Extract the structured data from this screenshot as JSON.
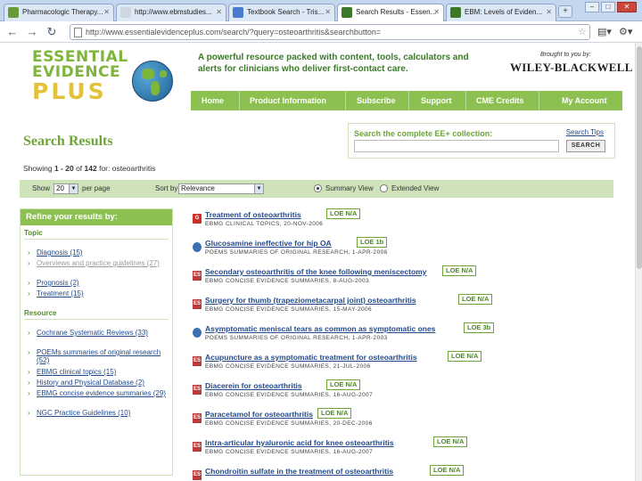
{
  "browser": {
    "tabs": [
      {
        "label": "Pharmacologic Therapy...",
        "favicon": "#6a9a3a",
        "active": false
      },
      {
        "label": "http://www.ebmstudies...",
        "favicon": "#cfd6e0",
        "active": false
      },
      {
        "label": "Textbook Search - Tris...",
        "favicon": "#4a7ad0",
        "active": false
      },
      {
        "label": "Search Results - Essen...",
        "favicon": "#3c7a2a",
        "active": true
      },
      {
        "label": "EBM: Levels of Eviden...",
        "favicon": "#3c7a2a",
        "active": false
      }
    ],
    "url": "http://www.essentialevidenceplus.com/search/?query=osteoarthritis&searchbutton="
  },
  "header": {
    "logo_line1": "ESSENTIAL",
    "logo_line2": "EVIDENCE",
    "logo_line3": "PLUS",
    "tagline": "A powerful resource packed with content, tools, calculators and alerts for clinicians who deliver first-contact care.",
    "brought_by": "Brought to you by:",
    "publisher": "WILEY-BLACKWELL"
  },
  "nav": {
    "items": [
      "Home",
      "Product Information",
      "Subscribe",
      "Support",
      "CME Credits",
      "My Account"
    ]
  },
  "search": {
    "title": "Search Results",
    "collection_label": "Search the complete EE+ collection:",
    "tips": "Search Tips",
    "button": "SEARCH",
    "query_value": ""
  },
  "showing": {
    "prefix": "Showing ",
    "range": "1 - 20",
    "mid": " of ",
    "total": "142",
    "suffix": " for: osteoarthritis"
  },
  "controls": {
    "show_label": "Show",
    "show_value": "20",
    "per_page": "per page",
    "sort_label": "Sort by",
    "sort_value": "Relevance",
    "summary_view": "Summary View",
    "extended_view": "Extended View"
  },
  "refine": {
    "heading": "Refine your results by:",
    "topic_label": "Topic",
    "topics": [
      {
        "label": "Diagnosis (15)",
        "dim": false
      },
      {
        "label": "Overviews and practice guidelines (27)",
        "dim": true
      },
      {
        "label": "Prognosis (2)",
        "dim": false
      },
      {
        "label": "Treatment (15)",
        "dim": false
      }
    ],
    "resource_label": "Resource",
    "resources": [
      "Cochrane Systematic Reviews (33)",
      "POEMs summaries of original research (52)",
      "EBMG clinical topics (15)",
      "History and Physical Database (2)",
      "EBMG concise evidence summaries (29)",
      "NGC Practice Guidelines (10)"
    ]
  },
  "results": [
    {
      "icon": "G",
      "kind": "g",
      "title": "Treatment of osteoarthritis",
      "loe": "LOE N/A",
      "source": "EBMG CLINICAL TOPICS, 20-NOV-2006"
    },
    {
      "icon": "",
      "kind": "p",
      "title": "Glucosamine ineffective for hip OA",
      "loe": "LOE 1b",
      "source": "POEMS SUMMARIES OF ORIGINAL RESEARCH, 1-APR-2008"
    },
    {
      "icon": "ES",
      "kind": "es",
      "title": "Secondary osteoarthritis of the knee following meniscectomy",
      "loe": "LOE N/A",
      "source": "EBMG CONCISE EVIDENCE SUMMARIES, 8-AUG-2003"
    },
    {
      "icon": "ES",
      "kind": "es",
      "title": "Surgery for thumb (trapeziometacarpal joint) osteoarthritis",
      "loe": "LOE N/A",
      "source": "EBMG CONCISE EVIDENCE SUMMARIES, 15-MAY-2006"
    },
    {
      "icon": "",
      "kind": "p",
      "title": "Asymptomatic meniscal tears as common as symptomatic ones",
      "loe": "LOE 3b",
      "source": "POEMS SUMMARIES OF ORIGINAL RESEARCH, 1-APR-2003"
    },
    {
      "icon": "ES",
      "kind": "es",
      "title": "Acupuncture as a symptomatic treatment for osteoarthritis",
      "loe": "LOE N/A",
      "source": "EBMG CONCISE EVIDENCE SUMMARIES, 21-JUL-2006"
    },
    {
      "icon": "ES",
      "kind": "es",
      "title": "Diacerein for osteoarthritis",
      "loe": "LOE N/A",
      "source": "EBMG CONCISE EVIDENCE SUMMARIES, 16-AUG-2007"
    },
    {
      "icon": "ES",
      "kind": "es",
      "title": "Paracetamol for osteoarthritis",
      "loe": "LOE N/A",
      "source": "EBMG CONCISE EVIDENCE SUMMARIES, 20-DEC-2006"
    },
    {
      "icon": "ES",
      "kind": "es",
      "title": "Intra-articular hyaluronic acid for knee osteoarthritis",
      "loe": "LOE N/A",
      "source": "EBMG CONCISE EVIDENCE SUMMARIES, 16-AUG-2007"
    },
    {
      "icon": "ES",
      "kind": "es",
      "title": "Chondroitin sulfate in the treatment of osteoarthritis",
      "loe": "LOE N/A",
      "source": ""
    }
  ],
  "colors": {
    "brand_green": "#8cc152",
    "title_green": "#6ea43a",
    "link_blue": "#234b8a"
  }
}
